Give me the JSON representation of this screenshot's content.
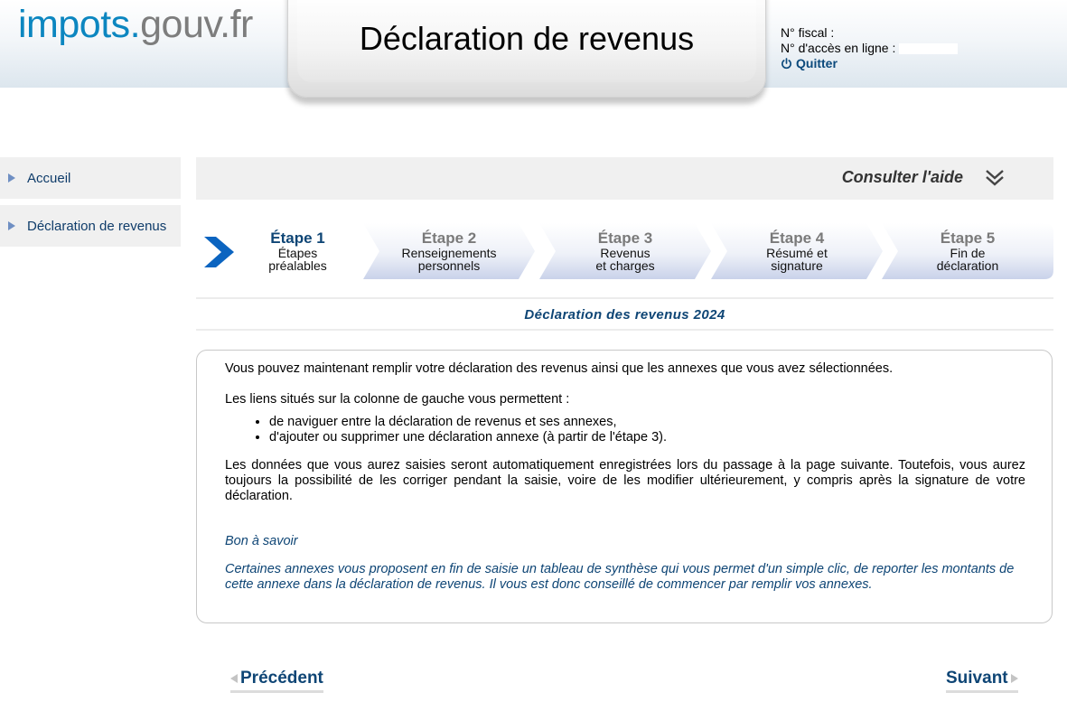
{
  "header": {
    "logo_part1": "impots.",
    "logo_part2": "gouv.fr",
    "title": "Déclaration de revenus",
    "fiscal_label": "N° fiscal :",
    "access_label": "N° d'accès en ligne :",
    "quit_label": "Quitter"
  },
  "sidebar": {
    "items": [
      {
        "label": "Accueil"
      },
      {
        "label": "Déclaration de revenus"
      }
    ]
  },
  "help": {
    "label": "Consulter l'aide"
  },
  "steps": [
    {
      "title": "Étape 1",
      "line1": "Étapes",
      "line2": "préalables",
      "current": true
    },
    {
      "title": "Étape 2",
      "line1": "Renseignements",
      "line2": "personnels",
      "current": false
    },
    {
      "title": "Étape 3",
      "line1": "Revenus",
      "line2": "et charges",
      "current": false
    },
    {
      "title": "Étape 4",
      "line1": "Résumé et",
      "line2": "signature",
      "current": false
    },
    {
      "title": "Étape 5",
      "line1": "Fin de",
      "line2": "déclaration",
      "current": false
    }
  ],
  "declaration_title": "Déclaration des revenus 2024",
  "content": {
    "p1": "Vous pouvez maintenant remplir votre déclaration des revenus ainsi que les annexes que vous avez sélectionnées.",
    "p2": "Les liens situés sur la colonne de gauche vous permettent :",
    "bullets": [
      "de naviguer entre la déclaration de revenus et ses annexes,",
      "d'ajouter ou supprimer une déclaration annexe (à partir de l'étape 3)."
    ],
    "p3": "Les données que vous aurez saisies seront automatiquement enregistrées lors du passage à la page suivante. Toutefois, vous aurez toujours la possibilité de les corriger pendant la saisie, voire de les modifier ultérieurement, y compris après la signature de votre déclaration.",
    "bon_title": "Bon à savoir",
    "bon_text": "Certaines annexes vous proposent en fin de saisie un tableau de synthèse qui vous permet d'un simple clic, de reporter les montants de cette annexe dans la déclaration de revenus. Il vous est donc conseillé de commencer par remplir vos annexes."
  },
  "nav": {
    "prev_label": "Précédent",
    "next_label": "Suivant"
  },
  "colors": {
    "brand_blue": "#0c86c0",
    "dark_blue": "#0e4575",
    "step_gradient_end": "#c9d2ea"
  }
}
